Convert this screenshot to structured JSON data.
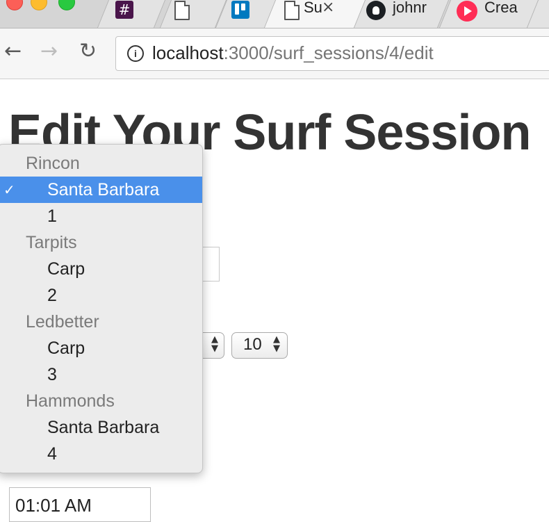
{
  "browser": {
    "tabs": [
      {
        "icon": "slack-icon",
        "glyph": "#"
      },
      {
        "icon": "document-icon"
      },
      {
        "icon": "trello-icon"
      },
      {
        "icon": "document-icon",
        "title": "Su",
        "active": true
      },
      {
        "icon": "github-icon",
        "title": "johnr"
      },
      {
        "icon": "creative-app-icon",
        "title": "Crea"
      }
    ],
    "close_glyph": "×",
    "address": {
      "host": "localhost",
      "path": ":3000/surf_sessions/4/edit"
    }
  },
  "page": {
    "title": "Edit Your Surf Session",
    "minute_select": {
      "value": "10"
    },
    "time_field": {
      "value": "01:01 AM"
    }
  },
  "dropdown": {
    "groups": [
      {
        "label": "Rincon",
        "options": [
          "Santa Barbara",
          "1"
        ]
      },
      {
        "label": "Tarpits",
        "options": [
          "Carp",
          "2"
        ]
      },
      {
        "label": "Ledbetter",
        "options": [
          "Carp",
          "3"
        ]
      },
      {
        "label": "Hammonds",
        "options": [
          "Santa Barbara",
          "4"
        ]
      }
    ],
    "selected": "Santa Barbara",
    "check_glyph": "✓"
  },
  "colors": {
    "selection": "#4a90ea",
    "title_text": "#333333",
    "group_label": "#7a7a7a"
  }
}
